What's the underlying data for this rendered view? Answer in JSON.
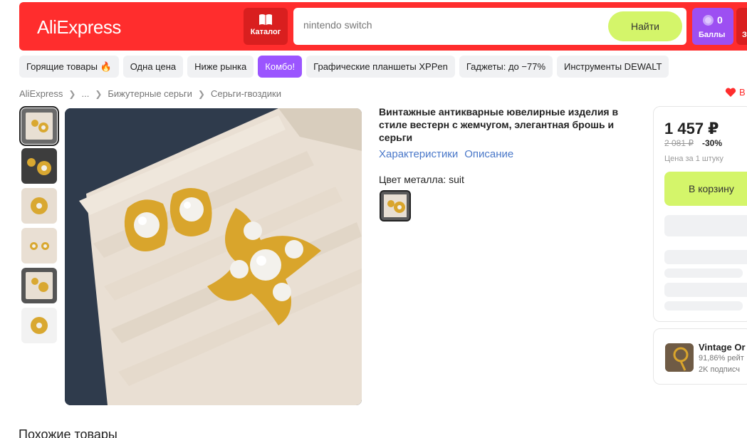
{
  "header": {
    "logo": "AliExpress",
    "catalog_label": "Каталог",
    "search_value": "nintendo switch",
    "search_button": "Найти",
    "points_count": "0",
    "points_label": "Баллы",
    "cart_label": "З"
  },
  "chips": [
    "Горящие товары 🔥",
    "Одна цена",
    "Ниже рынка",
    "Комбо!",
    "Графические планшеты XPPen",
    "Гаджеты: до −77%",
    "Инструменты DEWALT"
  ],
  "breadcrumb": [
    "AliExpress",
    "...",
    "Бижутерные серьги",
    "Серьги-гвоздики"
  ],
  "favorite_label": "В",
  "product": {
    "title": "Винтажные антикварные ювелирные изделия в стиле вестерн с жемчугом, элегантная брошь и серьги",
    "link_specs": "Характеристики",
    "link_description": "Описание",
    "color_label": "Цвет металла: suit"
  },
  "price": {
    "current": "1 457 ₽",
    "old": "2 081 ₽",
    "discount": "-30%",
    "per_unit": "Цена за 1 штуку",
    "cart_button": "В корзину"
  },
  "store": {
    "name": "Vintage Or",
    "rating": "91,86% рейт",
    "subscribers": "2K подписч"
  },
  "similar_title": "Похожие товары",
  "colors": {
    "brand_red": "#ff2d2d",
    "accent_green": "#d4f56a",
    "points_purple": "#9d4ff2",
    "chip_active": "#9b55ff",
    "link_blue": "#4a78c9"
  }
}
